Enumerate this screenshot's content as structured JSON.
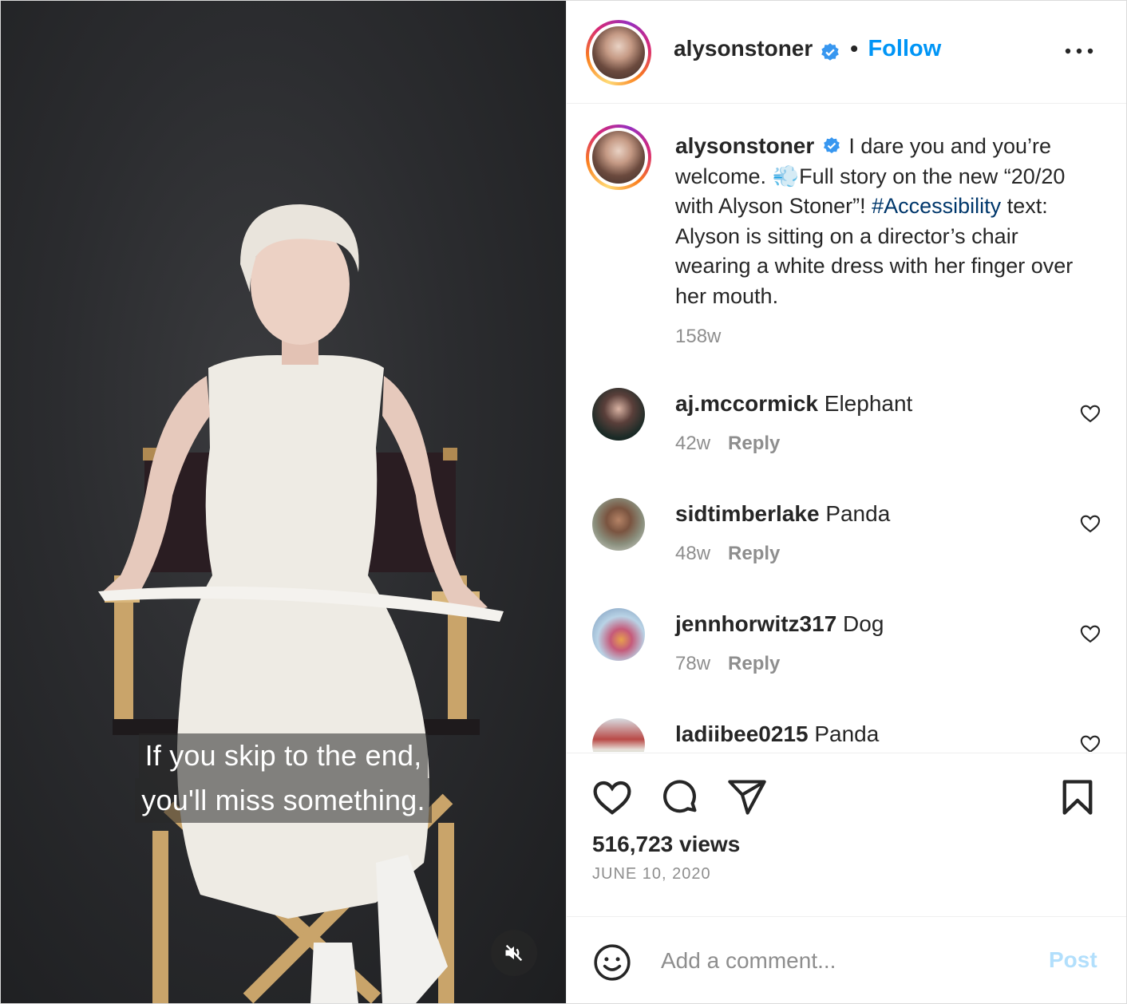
{
  "post": {
    "author": "alysonstoner",
    "follow_label": "Follow",
    "separator": "•",
    "more_label": "More options"
  },
  "video": {
    "subtitle_lines": [
      "If you skip to the end,",
      "you'll miss something."
    ],
    "muted": true
  },
  "caption": {
    "username": "alysonstoner",
    "text_part1": "I dare you and you’re welcome. ",
    "emoji": "💨",
    "text_part2": "Full story on the new “20/20 with Alyson Stoner”! ",
    "hashtag": "#Accessibility",
    "text_part3": " text: Alyson is sitting on a director’s chair wearing a white dress with her finger over her mouth.",
    "time": "158w"
  },
  "comments": [
    {
      "username": "aj.mccormick",
      "text": "Elephant",
      "time": "42w",
      "reply_label": "Reply"
    },
    {
      "username": "sidtimberlake",
      "text": "Panda",
      "time": "48w",
      "reply_label": "Reply"
    },
    {
      "username": "jennhorwitz317",
      "text": "Dog",
      "time": "78w",
      "reply_label": "Reply"
    },
    {
      "username": "ladiibee0215",
      "text": "Panda",
      "time": "",
      "reply_label": ""
    }
  ],
  "stats": {
    "views": "516,723 views",
    "date": "JUNE 10, 2020"
  },
  "comment_box": {
    "placeholder": "Add a comment...",
    "post_label": "Post"
  },
  "colors": {
    "accent": "#0095f6",
    "hashtag": "#00376b",
    "muted_text": "#8e8e8e",
    "post_disabled": "#b2dffc"
  }
}
